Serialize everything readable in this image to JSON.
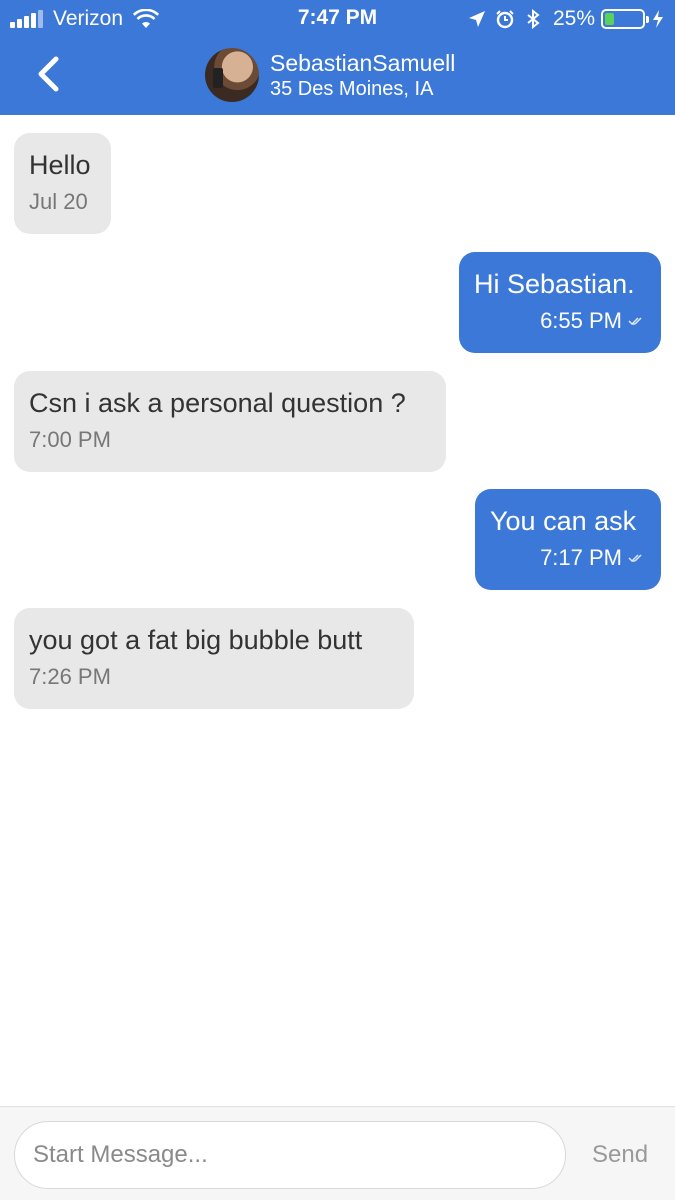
{
  "status_bar": {
    "carrier": "Verizon",
    "time": "7:47 PM",
    "battery": "25%",
    "battery_level": 0.25
  },
  "nav": {
    "back_icon": "chevron-left-icon",
    "contact_name": "SebastianSamuell",
    "contact_subtitle": "35 Des Moines, IA"
  },
  "messages": [
    {
      "direction": "incoming",
      "text": "Hello",
      "time": "Jul 20"
    },
    {
      "direction": "outgoing",
      "text": "Hi Sebastian.",
      "time": "6:55 PM"
    },
    {
      "direction": "incoming",
      "text": "Csn i ask a personal question ?",
      "time": "7:00 PM"
    },
    {
      "direction": "outgoing",
      "text": "You can ask",
      "time": "7:17 PM"
    },
    {
      "direction": "incoming",
      "text": "you got a fat big bubble butt",
      "time": "7:26 PM"
    }
  ],
  "composer": {
    "placeholder": "Start Message...",
    "send_label": "Send"
  },
  "colors": {
    "accent": "#3b78d8",
    "incoming_bubble": "#e8e8e8"
  }
}
